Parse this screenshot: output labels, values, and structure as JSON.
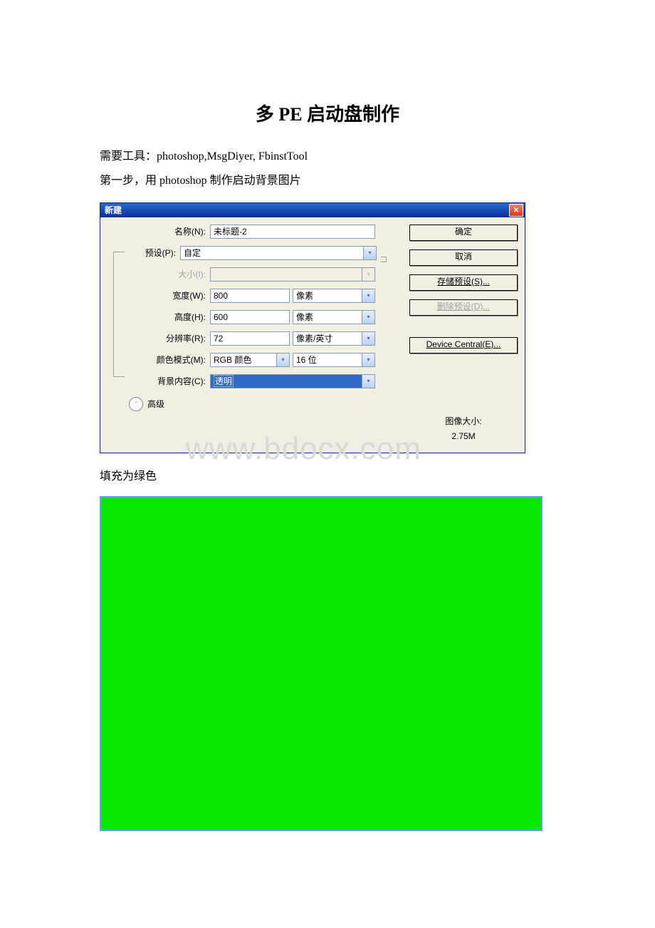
{
  "doc": {
    "title": "多 PE 启动盘制作",
    "line1": "需要工具：photoshop,MsgDiyer, FbinstTool",
    "line2": "第一步，用 photoshop 制作启动背景图片",
    "fill_text": "填充为绿色",
    "watermark": "www.bdocx.com"
  },
  "dialog": {
    "title": "新建",
    "close_x": "✕",
    "name_label": "名称(N):",
    "name_value": "未标题-2",
    "preset_label": "预设(P):",
    "preset_value": "自定",
    "size_label": "大小(I):",
    "width_label": "宽度(W):",
    "width_value": "800",
    "width_unit": "像素",
    "height_label": "高度(H):",
    "height_value": "600",
    "height_unit": "像素",
    "res_label": "分辨率(R):",
    "res_value": "72",
    "res_unit": "像素/英寸",
    "color_label": "颜色模式(M):",
    "color_mode": "RGB 颜色",
    "color_depth": "16 位",
    "bg_label": "背景内容(C):",
    "bg_value": "透明",
    "advanced_label": "高级",
    "advanced_glyph": "ˇ",
    "btn_ok": "确定",
    "btn_cancel": "取消",
    "btn_save_preset": "存储预设(S)...",
    "btn_delete_preset": "删除预设(D)...",
    "btn_device_central": "Device Central(E)...",
    "img_size_label": "图像大小:",
    "img_size_value": "2.75M"
  },
  "canvas": {
    "fill_color": "#0ae600"
  }
}
